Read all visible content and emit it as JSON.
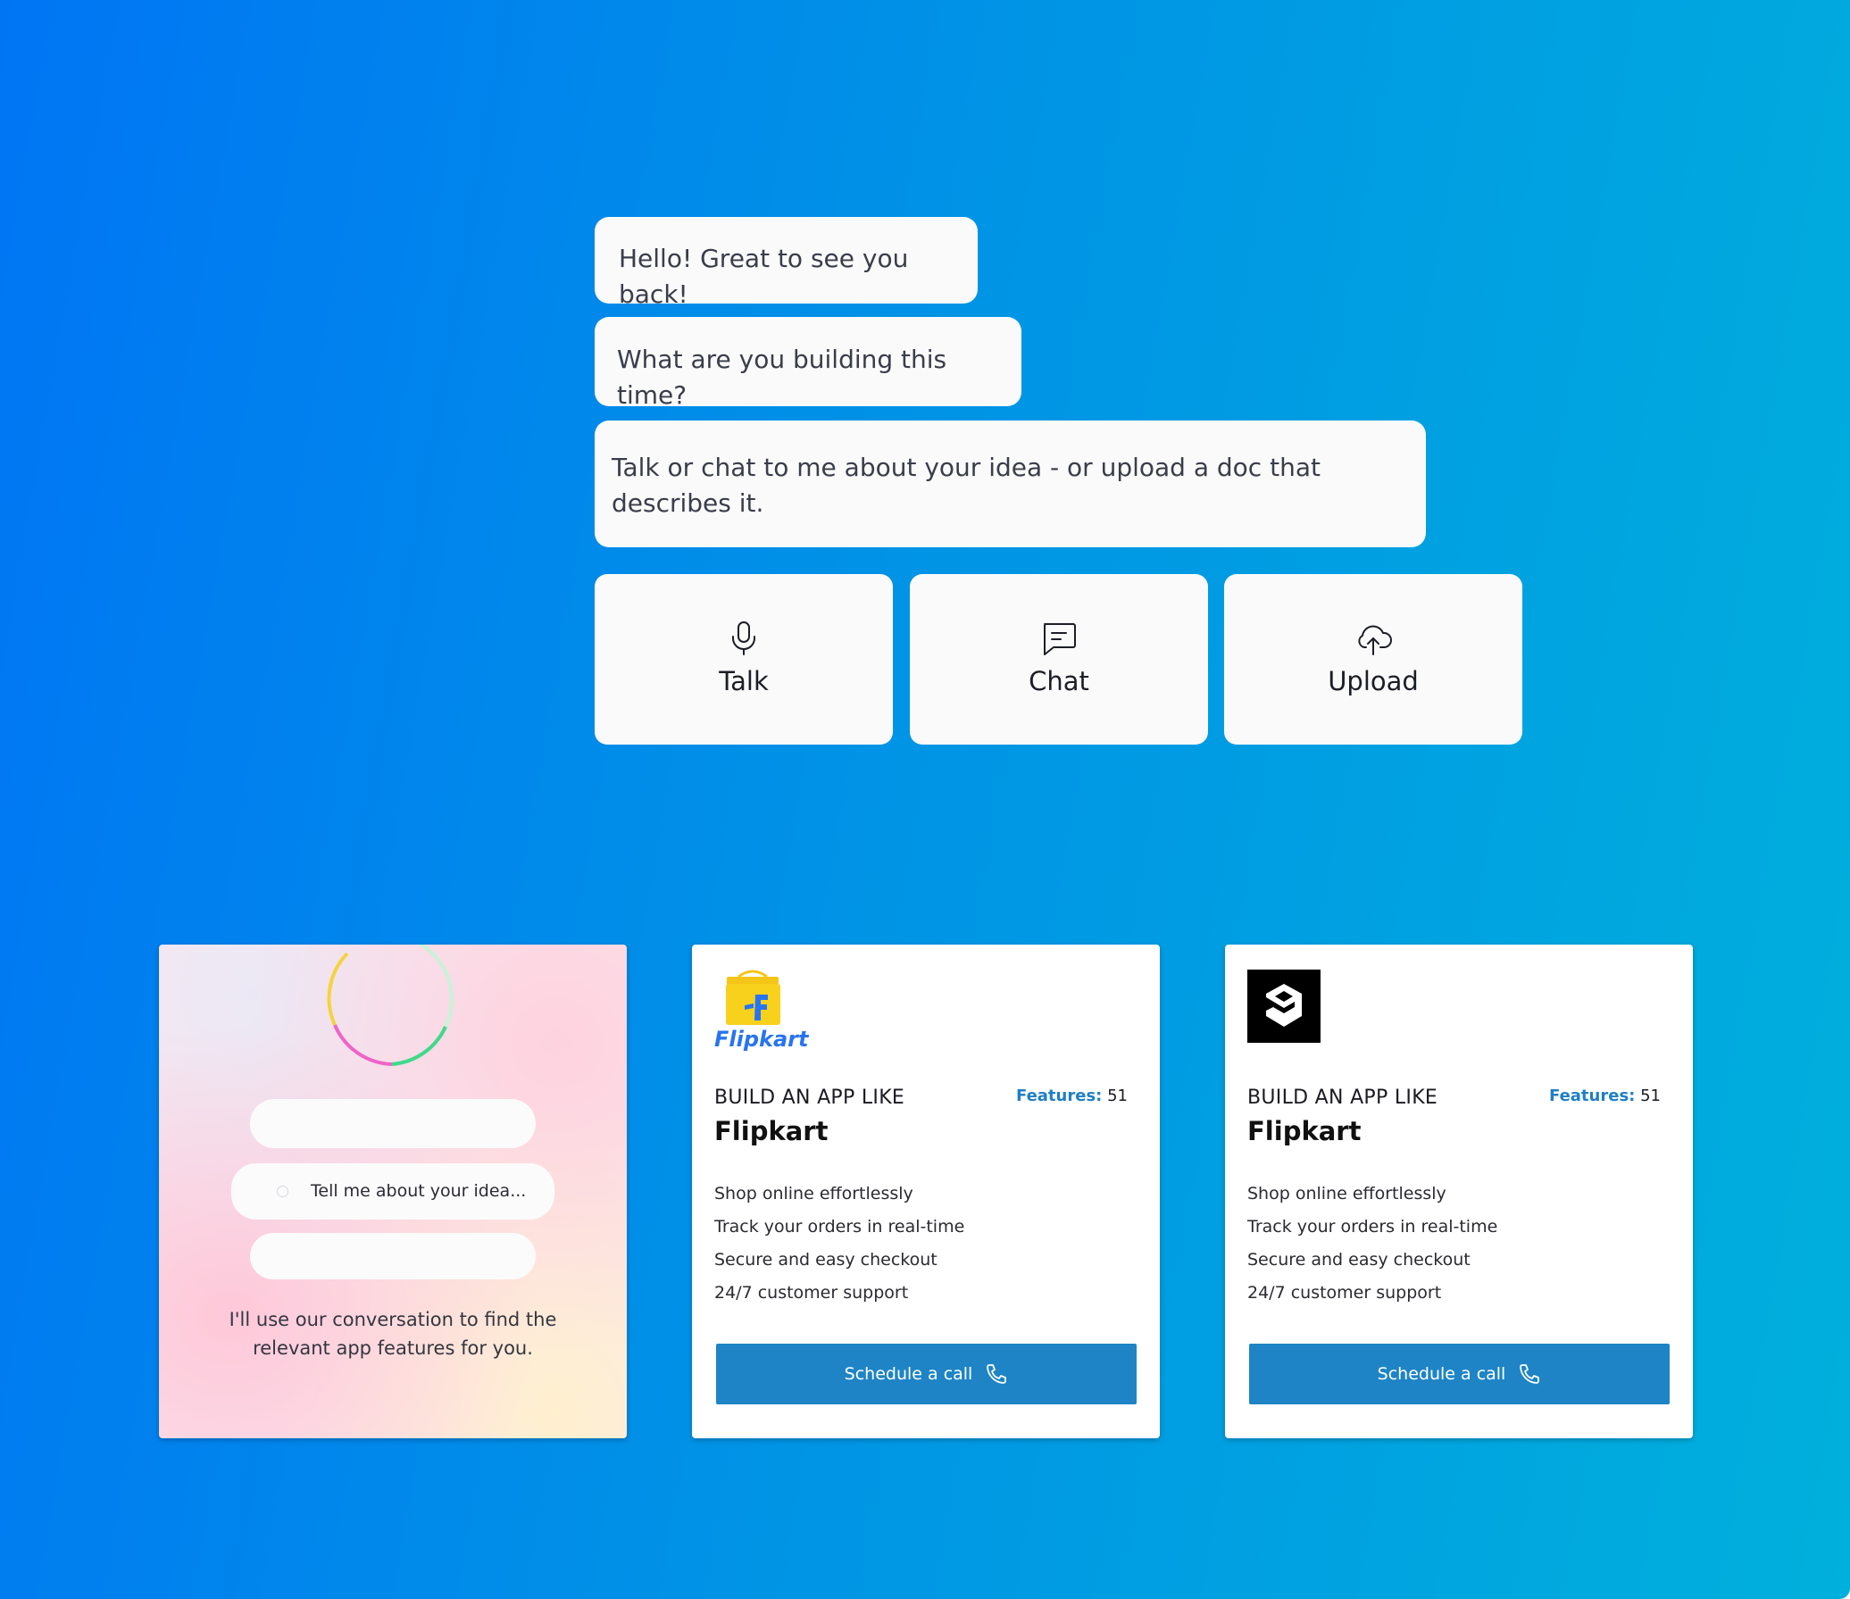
{
  "conversation": {
    "messages": [
      "Hello! Great to see you back!",
      "What are you building this time?",
      "Talk or chat to me about your idea - or upload a doc that describes it."
    ]
  },
  "actions": [
    {
      "label": "Talk",
      "icon": "microphone-icon"
    },
    {
      "label": "Chat",
      "icon": "chat-icon"
    },
    {
      "label": "Upload",
      "icon": "cloud-upload-icon"
    }
  ],
  "assistant_panel": {
    "input_placeholder": "Tell me about your idea...",
    "caption_line1": "I'll use our conversation to find the",
    "caption_line2": "relevant app features for you."
  },
  "app_cards": [
    {
      "logo": "flipkart-logo",
      "logo_text": "Flipkart",
      "build_label": "BUILD AN APP LIKE",
      "features_label": "Features:",
      "features_count": "51",
      "app_name": "Flipkart",
      "features": [
        "Shop online effortlessly",
        "Track your orders in real-time",
        "Secure and easy checkout",
        "24/7 customer support"
      ],
      "cta_label": "Schedule a call"
    },
    {
      "logo": "9gag-logo",
      "build_label": "BUILD AN APP LIKE",
      "features_label": "Features:",
      "features_count": "51",
      "app_name": "Flipkart",
      "features": [
        "Shop online effortlessly",
        "Track your orders in real-time",
        "Secure and easy checkout",
        "24/7 customer support"
      ],
      "cta_label": "Schedule a call"
    }
  ],
  "colors": {
    "background_start": "#0075f4",
    "background_end": "#00b0dc",
    "cta": "#1e84c6",
    "features_accent": "#1f7fc5",
    "flipkart_blue": "#2874f0",
    "flipkart_yellow": "#f8d11c"
  }
}
